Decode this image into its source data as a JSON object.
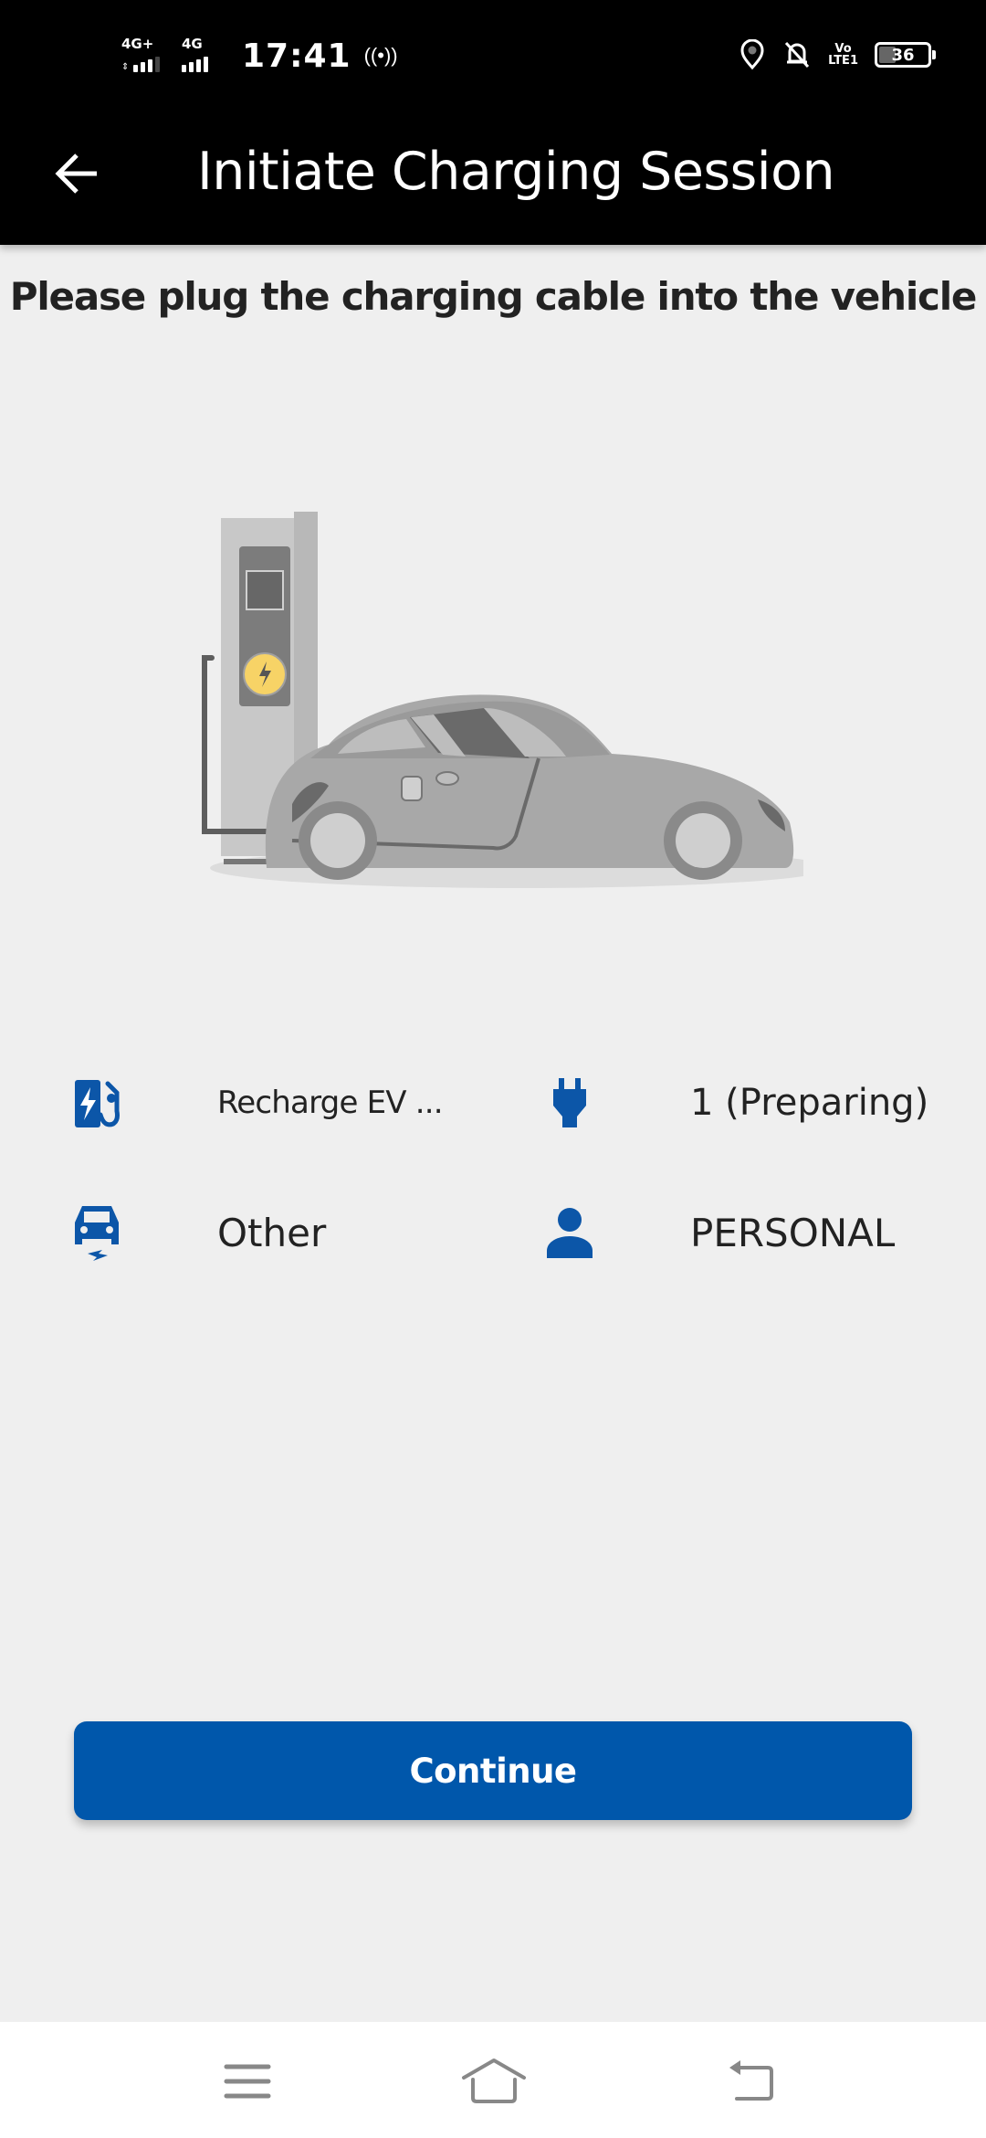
{
  "status_bar": {
    "sim1_network": "4G+",
    "sim1_signal_level": 3,
    "sim2_network": "4G",
    "sim2_signal_level": 4,
    "time": "17:41",
    "hotspot_count": "1",
    "volte_label_top": "Vo",
    "volte_label_bottom": "LTE1",
    "battery_percent": "36",
    "icons": [
      "location-icon",
      "bell-off-icon",
      "volte-icon",
      "battery-icon"
    ]
  },
  "app_bar": {
    "title": "Initiate Charging Session",
    "back_icon": "arrow-left-icon"
  },
  "instruction": "Please plug the charging cable into the vehicle",
  "illustration": {
    "description": "ev-charging-station-with-car",
    "accent_color": "#f7d366"
  },
  "info": {
    "station": {
      "icon": "ev-station-icon",
      "value": "Recharge EV ..."
    },
    "connector": {
      "icon": "plug-icon",
      "value": "1 (Preparing)"
    },
    "vehicle": {
      "icon": "electric-car-icon",
      "value": "Other"
    },
    "profile": {
      "icon": "person-icon",
      "value": "PERSONAL"
    }
  },
  "continue_button": {
    "label": "Continue"
  },
  "nav_bar": {
    "items": [
      "menu-icon",
      "home-icon",
      "back-icon"
    ]
  },
  "colors": {
    "primary": "#0057ab",
    "icon_blue": "#0c56a8",
    "background": "#efefef",
    "header": "#000000"
  }
}
